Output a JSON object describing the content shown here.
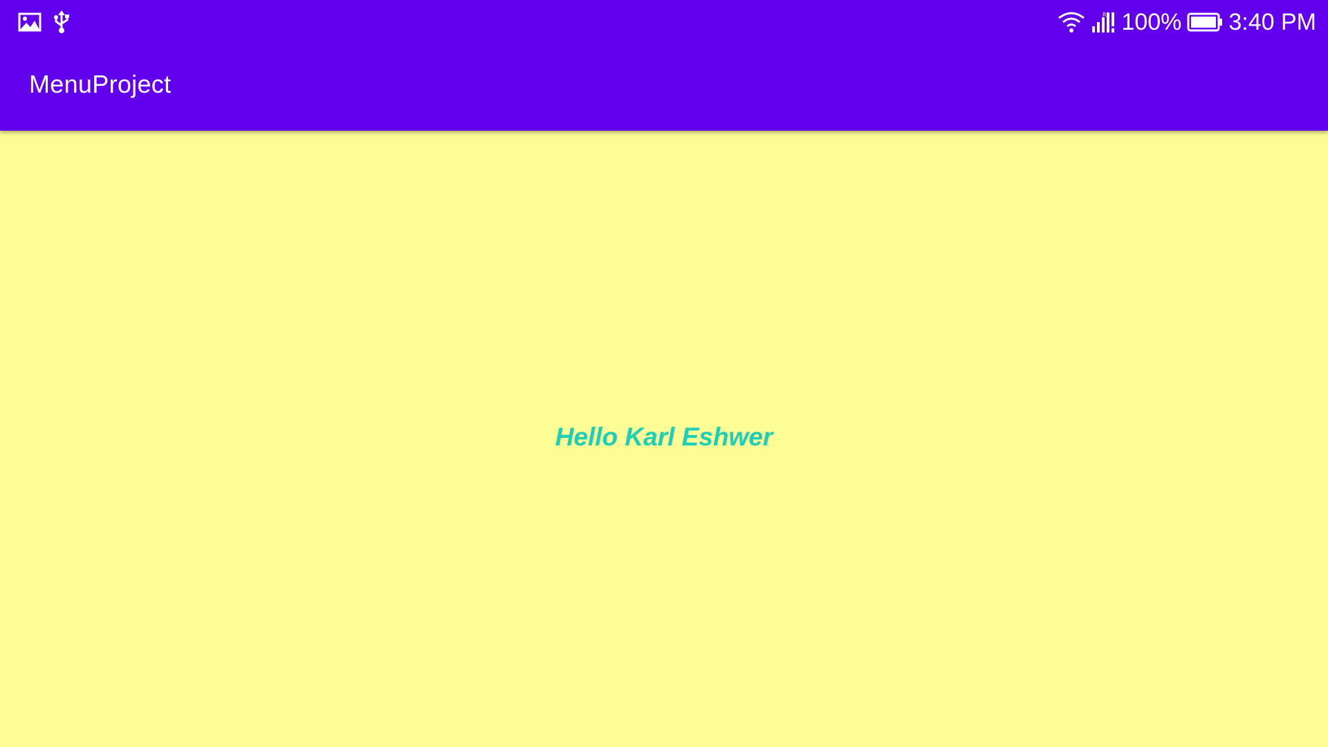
{
  "status_bar": {
    "left_icons": [
      "image-notification-icon",
      "usb-icon"
    ],
    "right_icons": [
      "wifi-icon",
      "cell-signal-icon",
      "battery-icon"
    ],
    "battery_percent": "100%",
    "battery_level": 1.0,
    "time": "3:40 PM"
  },
  "app_bar": {
    "title": "MenuProject"
  },
  "main": {
    "greeting": "Hello Karl Eshwer"
  },
  "colors": {
    "primary": "#6200ee",
    "background": "#fcfd95",
    "greeting_text": "#1ecfb8",
    "on_primary": "#ffffff"
  }
}
